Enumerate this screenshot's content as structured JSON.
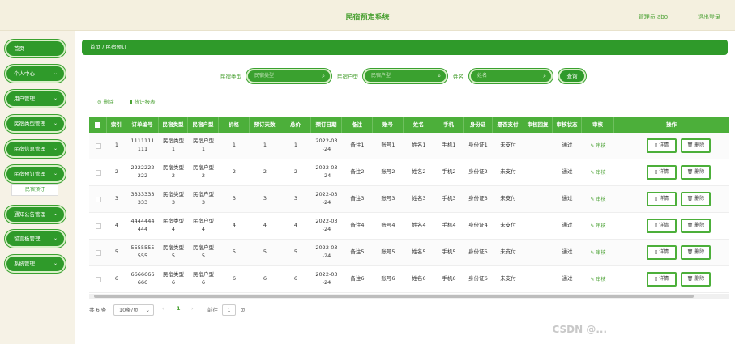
{
  "header": {
    "title": "民宿预定系统",
    "user": "管理员 abo",
    "logout": "退出登录"
  },
  "sidebar": {
    "items": [
      {
        "label": "首页",
        "chevron": ""
      },
      {
        "label": "个人中心",
        "chevron": "⌄"
      },
      {
        "label": "用户管理",
        "chevron": "⌄"
      },
      {
        "label": "民宿类型管理",
        "chevron": "⌄"
      },
      {
        "label": "民宿信息管理",
        "chevron": "⌄"
      },
      {
        "label": "民宿预订管理",
        "chevron": "⌄"
      },
      {
        "label": "通知公告管理",
        "chevron": "⌄"
      },
      {
        "label": "留言板管理",
        "chevron": "⌄"
      },
      {
        "label": "系统管理",
        "chevron": "⌄"
      }
    ],
    "submenu": "民宿预订"
  },
  "breadcrumb": "首页 / 民宿预订",
  "search": {
    "type_label": "民宿类型",
    "type_placeholder": "民宿类型",
    "house_label": "民宿户型",
    "house_placeholder": "民宿户型",
    "name_label": "姓名",
    "name_placeholder": "姓名",
    "query": "查询"
  },
  "tools": {
    "delete": "⊝ 删除",
    "stats": "▮ 统计报表"
  },
  "table": {
    "headers": [
      "索引",
      "订单编号",
      "民宿类型",
      "民宿户型",
      "价格",
      "预订天数",
      "总价",
      "预订日期",
      "备注",
      "账号",
      "姓名",
      "手机",
      "身份证",
      "是否支付",
      "审核回复",
      "审核状态",
      "审核",
      "操作"
    ],
    "rows": [
      {
        "idx": "1",
        "order": "1111111\n111",
        "type": "民宿类型\n1",
        "house": "民宿户型\n1",
        "price": "1",
        "days": "1",
        "total": "1",
        "date": "2022-03\n-24",
        "note": "备注1",
        "account": "账号1",
        "name": "姓名1",
        "phone": "手机1",
        "idcard": "身份证1",
        "paid": "未支付",
        "reply": "",
        "status": "通过",
        "audit": "✎ 审核"
      },
      {
        "idx": "2",
        "order": "2222222\n222",
        "type": "民宿类型\n2",
        "house": "民宿户型\n2",
        "price": "2",
        "days": "2",
        "total": "2",
        "date": "2022-03\n-24",
        "note": "备注2",
        "account": "账号2",
        "name": "姓名2",
        "phone": "手机2",
        "idcard": "身份证2",
        "paid": "未支付",
        "reply": "",
        "status": "通过",
        "audit": "✎ 审核"
      },
      {
        "idx": "3",
        "order": "3333333\n333",
        "type": "民宿类型\n3",
        "house": "民宿户型\n3",
        "price": "3",
        "days": "3",
        "total": "3",
        "date": "2022-03\n-24",
        "note": "备注3",
        "account": "账号3",
        "name": "姓名3",
        "phone": "手机3",
        "idcard": "身份证3",
        "paid": "未支付",
        "reply": "",
        "status": "通过",
        "audit": "✎ 审核"
      },
      {
        "idx": "4",
        "order": "4444444\n444",
        "type": "民宿类型\n4",
        "house": "民宿户型\n4",
        "price": "4",
        "days": "4",
        "total": "4",
        "date": "2022-03\n-24",
        "note": "备注4",
        "account": "账号4",
        "name": "姓名4",
        "phone": "手机4",
        "idcard": "身份证4",
        "paid": "未支付",
        "reply": "",
        "status": "通过",
        "audit": "✎ 审核"
      },
      {
        "idx": "5",
        "order": "5555555\n555",
        "type": "民宿类型\n5",
        "house": "民宿户型\n5",
        "price": "5",
        "days": "5",
        "total": "5",
        "date": "2022-03\n-24",
        "note": "备注5",
        "account": "账号5",
        "name": "姓名5",
        "phone": "手机5",
        "idcard": "身份证5",
        "paid": "未支付",
        "reply": "",
        "status": "通过",
        "audit": "✎ 审核"
      },
      {
        "idx": "6",
        "order": "6666666\n666",
        "type": "民宿类型\n6",
        "house": "民宿户型\n6",
        "price": "6",
        "days": "6",
        "total": "6",
        "date": "2022-03\n-24",
        "note": "备注6",
        "account": "账号6",
        "name": "姓名6",
        "phone": "手机6",
        "idcard": "身份证6",
        "paid": "未支付",
        "reply": "",
        "status": "通过",
        "audit": "✎ 审核"
      }
    ],
    "detail_btn": "▯ 详情",
    "delete_btn": "🗑 删除"
  },
  "pager": {
    "total": "共 6 条",
    "page_size": "10条/页",
    "current": "1",
    "goto": "前往",
    "goto_value": "1",
    "page_unit": "页"
  },
  "watermark": "CSDN @...",
  "colors": {
    "accent": "#2f9a2a",
    "header_bg": "#4caf3a"
  }
}
